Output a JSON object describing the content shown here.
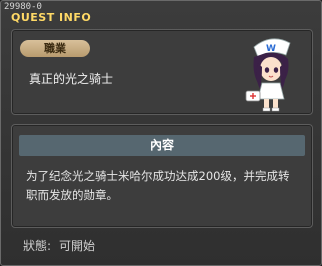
{
  "window": {
    "quest_id": "29980-0",
    "title": "QUEST INFO"
  },
  "quest": {
    "job_label": "職業",
    "name": "真正的光之骑士",
    "npc_icon": "nurse-npc-portrait"
  },
  "content": {
    "header": "內容",
    "description": "为了纪念光之骑士米哈尔成功达成200级，并完成转职而发放的勋章。"
  },
  "status": {
    "label": "狀態:",
    "value": "可開始"
  },
  "colors": {
    "title": "#ffd966",
    "badge": "#c8ab7e",
    "header_bar": "#566770"
  }
}
